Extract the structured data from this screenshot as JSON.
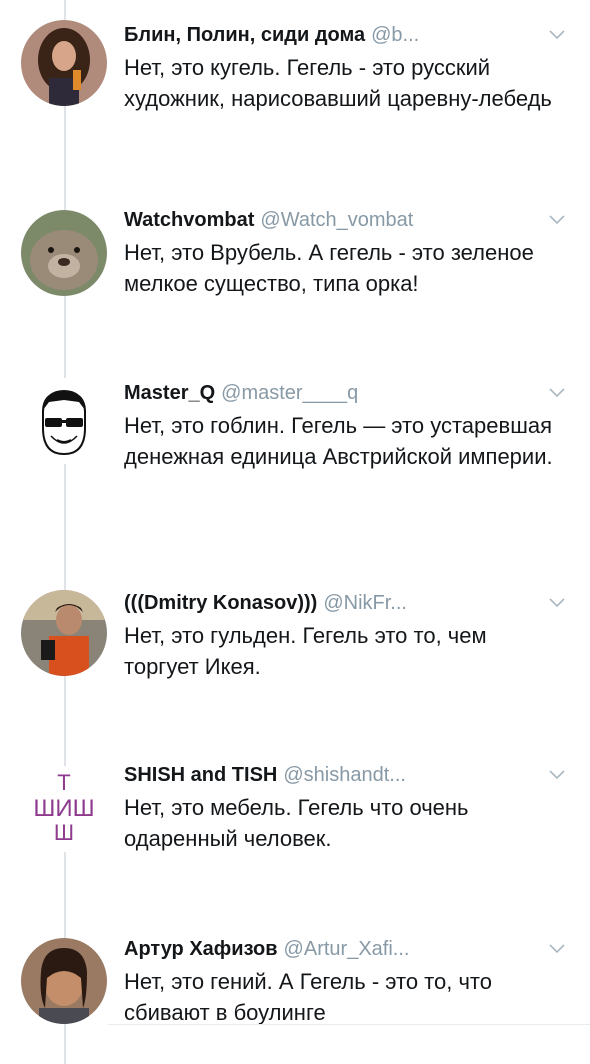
{
  "tweets": [
    {
      "name": "Блин, Полин, сиди дома",
      "handle": "@b...",
      "text": "Нет, это кугель. Гегель - это русский художник, нарисовавший царевну-лебедь",
      "avatar": "woman-portrait-avatar"
    },
    {
      "name": "Watchvombat",
      "handle": "@Watch_vombat",
      "text": "Нет, это Врубель. А гегель - это зеленое мелкое существо, типа орка!",
      "avatar": "wombat-avatar"
    },
    {
      "name": "Master_Q",
      "handle": "@master____q",
      "text": "Нет, это гоблин. Гегель — это устаревшая денежная единица Австрийской империи.",
      "avatar": "sunglasses-face-avatar"
    },
    {
      "name": "(((Dmitry Konasov)))",
      "handle": "@NikFr...",
      "text": "Нет, это гульден. Гегель это то, чем торгует Икея.",
      "avatar": "man-selfie-avatar"
    },
    {
      "name": "SHISH and TISH",
      "handle": "@shishandt...",
      "text": "Нет, это мебель. Гегель что очень одаренный человек.",
      "avatar": "shish-logo-avatar",
      "logo_letters": {
        "top": "Т",
        "middle": "ШИШ",
        "bottom": "Ш"
      }
    },
    {
      "name": "Артур Хафизов",
      "handle": "@Artur_Xafi...",
      "text": "Нет, это гений. А Гегель - это то, что сбивают в боулинге",
      "avatar": "man-portrait-avatar"
    }
  ],
  "colors": {
    "name": "#14171a",
    "handle": "#8899a6",
    "thread_line": "#dfe3e8",
    "logo_purple": "#8e3b8e"
  }
}
